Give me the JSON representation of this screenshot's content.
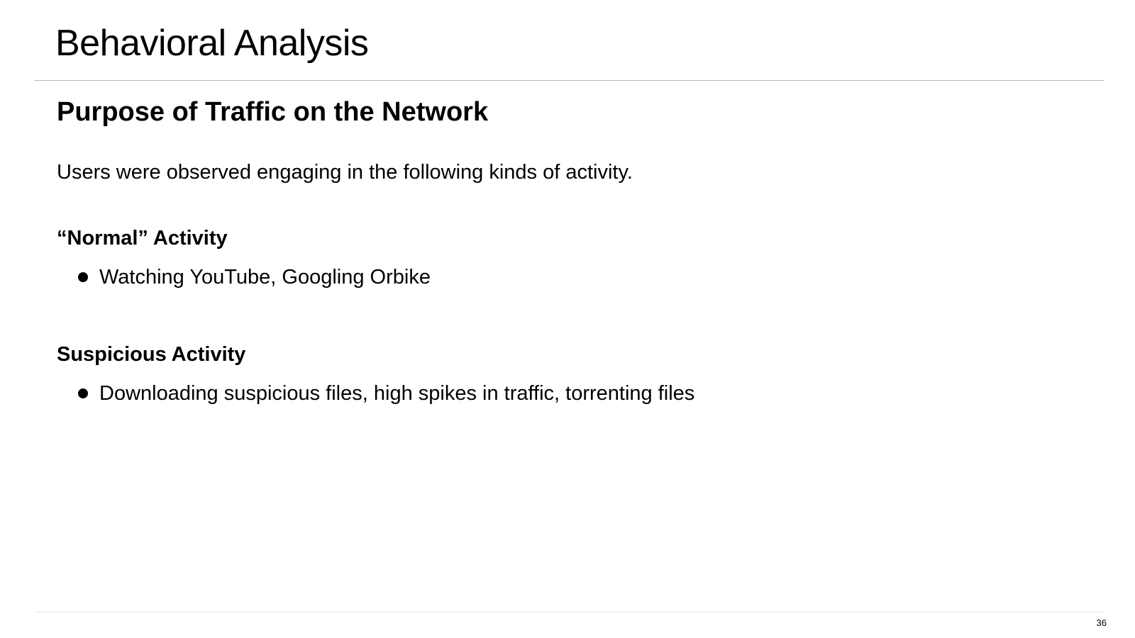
{
  "slide": {
    "title": "Behavioral Analysis",
    "subtitle": "Purpose of Traffic on the Network",
    "intro": "Users were observed engaging in the following kinds of activity.",
    "sections": [
      {
        "heading": "“Normal” Activity",
        "items": [
          "Watching YouTube, Googling Orbike"
        ]
      },
      {
        "heading": "Suspicious Activity",
        "items": [
          "Downloading suspicious files, high spikes in traffic, torrenting files"
        ]
      }
    ],
    "page_number": "36"
  }
}
